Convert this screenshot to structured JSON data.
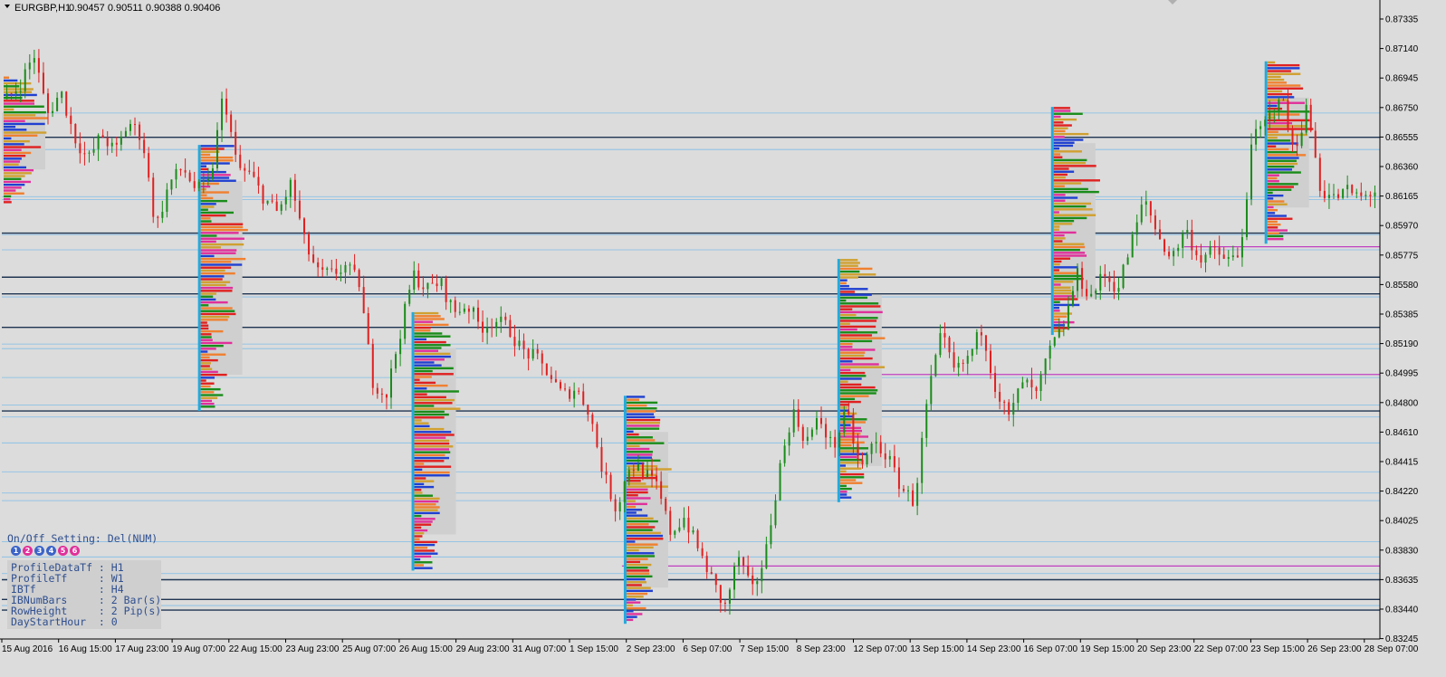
{
  "header": {
    "symbol": "EURGBP,H1",
    "ohlc": "0.90457 0.90511 0.90388 0.90406"
  },
  "colors": {
    "background": "#dcdcdc",
    "bull": "#1a8c1a",
    "bear": "#e02020",
    "grid_heavy": "#1f3552",
    "grid_light": "#7fbde8",
    "level_magenta": "#c040c0",
    "profile_blue": "#22aadd"
  },
  "info_panel": {
    "onoff": "On/Off Setting: Del(NUM)",
    "toggles": [
      {
        "label": "1",
        "color": "#3c64c8"
      },
      {
        "label": "2",
        "color": "#e0309a"
      },
      {
        "label": "3",
        "color": "#3c64c8"
      },
      {
        "label": "4",
        "color": "#3c64c8"
      },
      {
        "label": "5",
        "color": "#e0309a"
      },
      {
        "label": "6",
        "color": "#e0309a"
      }
    ],
    "settings": [
      "ProfileDataTf : H1",
      "ProfileTf     : W1",
      "IBTf          : H4",
      "IBNumBars     : 2 Bar(s)",
      "RowHeight     : 2 Pip(s)",
      "DayStartHour  : 0"
    ]
  },
  "chart_data": {
    "type": "candlestick",
    "ylim": [
      0.833,
      0.8742
    ],
    "y_ticks": [
      "0.87335",
      "0.87140",
      "0.86945",
      "0.86750",
      "0.86555",
      "0.86360",
      "0.86165",
      "0.85970",
      "0.85775",
      "0.85580",
      "0.85385",
      "0.85190",
      "0.84995",
      "0.84800",
      "0.84610",
      "0.84415",
      "0.84220",
      "0.84025",
      "0.83830",
      "0.83635",
      "0.83440",
      "0.83245"
    ],
    "x_ticks": [
      "15 Aug 2016",
      "16 Aug 15:00",
      "17 Aug 23:00",
      "19 Aug 07:00",
      "22 Aug 15:00",
      "23 Aug 23:00",
      "25 Aug 07:00",
      "26 Aug 15:00",
      "29 Aug 23:00",
      "31 Aug 07:00",
      "1 Sep 15:00",
      "2 Sep 23:00",
      "6 Sep 07:00",
      "7 Sep 15:00",
      "8 Sep 23:00",
      "12 Sep 07:00",
      "13 Sep 15:00",
      "14 Sep 23:00",
      "16 Sep 07:00",
      "19 Sep 15:00",
      "20 Sep 23:00",
      "22 Sep 07:00",
      "23 Sep 15:00",
      "26 Sep 23:00",
      "28 Sep 07:00"
    ],
    "price_path": [
      0.8685,
      0.8695,
      0.8715,
      0.8675,
      0.869,
      0.866,
      0.8645,
      0.8662,
      0.865,
      0.867,
      0.866,
      0.86,
      0.863,
      0.864,
      0.8625,
      0.863,
      0.869,
      0.864,
      0.8635,
      0.862,
      0.861,
      0.863,
      0.859,
      0.857,
      0.857,
      0.8575,
      0.8565,
      0.85,
      0.849,
      0.853,
      0.857,
      0.856,
      0.8565,
      0.8545,
      0.855,
      0.8535,
      0.854,
      0.8535,
      0.852,
      0.8515,
      0.8505,
      0.849,
      0.8495,
      0.848,
      0.844,
      0.8415,
      0.8445,
      0.844,
      0.843,
      0.84,
      0.841,
      0.839,
      0.837,
      0.835,
      0.8385,
      0.836,
      0.8385,
      0.844,
      0.848,
      0.846,
      0.8475,
      0.8455,
      0.848,
      0.844,
      0.846,
      0.845,
      0.843,
      0.842,
      0.849,
      0.853,
      0.8505,
      0.8515,
      0.8535,
      0.8495,
      0.8475,
      0.85,
      0.849,
      0.852,
      0.8535,
      0.857,
      0.8555,
      0.857,
      0.856,
      0.859,
      0.862,
      0.8595,
      0.858,
      0.86,
      0.858,
      0.8585,
      0.858,
      0.858,
      0.866,
      0.867,
      0.869,
      0.865,
      0.868,
      0.8625,
      0.862,
      0.8625,
      0.862,
      0.8625
    ],
    "horizontal_levels": {
      "heavy": [
        0.866,
        0.8597,
        0.8568,
        0.8557,
        0.8535,
        0.848,
        0.8369,
        0.8356,
        0.8349
      ],
      "light": [
        0.8676,
        0.8652,
        0.8621,
        0.8619,
        0.8596,
        0.8586,
        0.8555,
        0.8524,
        0.8521,
        0.8502,
        0.8484,
        0.8476,
        0.8459,
        0.844,
        0.8426,
        0.8421,
        0.8394,
        0.8384,
        0.8373,
        0.8352
      ],
      "magenta": [
        {
          "price": 0.8588,
          "from": 0.858,
          "to": 1.0
        },
        {
          "price": 0.8504,
          "from": 0.635,
          "to": 1.0
        },
        {
          "price": 0.8378,
          "from": 0.45,
          "to": 1.0
        }
      ]
    }
  }
}
